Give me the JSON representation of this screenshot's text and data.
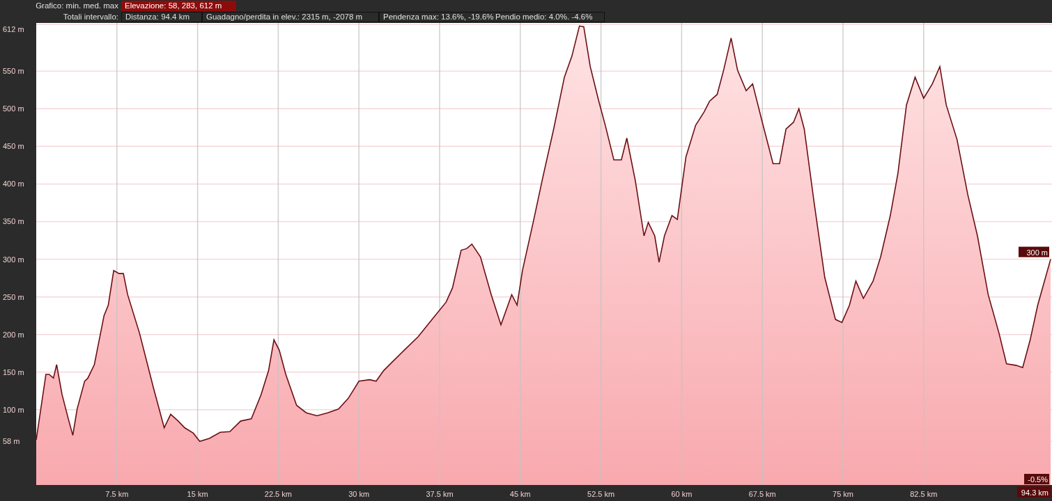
{
  "header": {
    "chart_label": "Grafico: min. med. max",
    "chart_value": "Elevazione: 58, 283, 612 m",
    "totals_label": "Totali intervallo:",
    "totals": [
      "Distanza: 94.4 km",
      "Guadagno/perdita in elev.: 2315 m, -2078 m",
      "Pendenza max: 13.6%, -19.6%",
      "Pendio medio: 4.0%. -4.6%"
    ]
  },
  "cursor": {
    "elevation": "300 m",
    "slope": "-0.5%",
    "distance": "94.3 km"
  },
  "chart_data": {
    "type": "area",
    "xlim": [
      0,
      94.3
    ],
    "ylim": [
      0,
      614
    ],
    "xticks": [
      {
        "value": 7.5,
        "label": "7.5 km"
      },
      {
        "value": 15,
        "label": "15 km"
      },
      {
        "value": 22.5,
        "label": "22.5 km"
      },
      {
        "value": 30,
        "label": "30 km"
      },
      {
        "value": 37.5,
        "label": "37.5 km"
      },
      {
        "value": 45,
        "label": "45 km"
      },
      {
        "value": 52.5,
        "label": "52.5 km"
      },
      {
        "value": 60,
        "label": "60 km"
      },
      {
        "value": 67.5,
        "label": "67.5 km"
      },
      {
        "value": 75,
        "label": "75 km"
      },
      {
        "value": 82.5,
        "label": "82.5 km"
      }
    ],
    "yticks": [
      {
        "value": 58,
        "label": "58 m"
      },
      {
        "value": 100,
        "label": "100 m"
      },
      {
        "value": 150,
        "label": "150 m"
      },
      {
        "value": 200,
        "label": "200 m"
      },
      {
        "value": 250,
        "label": "250 m"
      },
      {
        "value": 300,
        "label": "300 m"
      },
      {
        "value": 350,
        "label": "350 m"
      },
      {
        "value": 400,
        "label": "400 m"
      },
      {
        "value": 450,
        "label": "450 m"
      },
      {
        "value": 500,
        "label": "500 m"
      },
      {
        "value": 550,
        "label": "550 m"
      },
      {
        "value": 612,
        "label": "612 m"
      }
    ],
    "x": [
      0,
      0.9,
      1.2,
      1.6,
      1.9,
      2.4,
      3.0,
      3.4,
      3.8,
      4.5,
      4.8,
      5.4,
      6.3,
      6.7,
      7.2,
      7.7,
      8.1,
      8.5,
      9.6,
      10.9,
      11.9,
      12.5,
      13.2,
      13.8,
      14.6,
      15.2,
      16.1,
      17.1,
      18.0,
      19.0,
      20.0,
      20.9,
      21.6,
      22.1,
      22.6,
      23.2,
      24.2,
      25.1,
      26.1,
      27.1,
      28.1,
      29.0,
      30.0,
      31.0,
      31.6,
      32.3,
      33.2,
      34.2,
      35.5,
      36.8,
      38.1,
      38.7,
      39.5,
      40.0,
      40.5,
      41.3,
      42.3,
      43.2,
      44.2,
      44.7,
      45.2,
      46.2,
      47.1,
      48.1,
      49.1,
      49.8,
      50.5,
      50.9,
      51.5,
      52.3,
      52.9,
      53.7,
      54.4,
      54.9,
      55.7,
      56.5,
      56.9,
      57.5,
      57.9,
      58.4,
      59.1,
      59.6,
      60.4,
      61.3,
      62.1,
      62.6,
      63.3,
      63.9,
      64.6,
      65.2,
      66.0,
      66.6,
      67.5,
      68.5,
      69.1,
      69.7,
      70.4,
      70.9,
      71.4,
      72.3,
      73.3,
      74.3,
      74.9,
      75.6,
      76.2,
      76.9,
      77.8,
      78.5,
      79.4,
      80.1,
      80.9,
      81.7,
      82.5,
      83.3,
      84.0,
      84.6,
      85.6,
      86.6,
      87.5,
      88.5,
      89.5,
      90.2,
      91.1,
      91.7,
      92.4,
      93.1,
      94.3
    ],
    "grid": true,
    "series": [
      {
        "color": "#6b0f14",
        "values": [
          60,
          147,
          147,
          142,
          160,
          120,
          87,
          66,
          101,
          138,
          142,
          160,
          225,
          239,
          285,
          281,
          281,
          253,
          202,
          129,
          76,
          94,
          85,
          76,
          69,
          58,
          62,
          70,
          71,
          85,
          88,
          120,
          152,
          193,
          179,
          147,
          106,
          96,
          92,
          96,
          101,
          115,
          138,
          140,
          138,
          152,
          165,
          179,
          197,
          220,
          243,
          262,
          312,
          314,
          320,
          303,
          253,
          213,
          253,
          239,
          285,
          349,
          409,
          473,
          542,
          570,
          610,
          609,
          556,
          510,
          478,
          432,
          432,
          461,
          404,
          331,
          349,
          331,
          296,
          331,
          358,
          353,
          436,
          478,
          496,
          510,
          519,
          551,
          594,
          551,
          524,
          533,
          482,
          427,
          427,
          473,
          482,
          500,
          473,
          377,
          276,
          220,
          216,
          239,
          271,
          248,
          271,
          303,
          358,
          414,
          505,
          542,
          514,
          533,
          556,
          505,
          459,
          386,
          331,
          253,
          202,
          161,
          159,
          156,
          193,
          239,
          300
        ]
      }
    ]
  }
}
